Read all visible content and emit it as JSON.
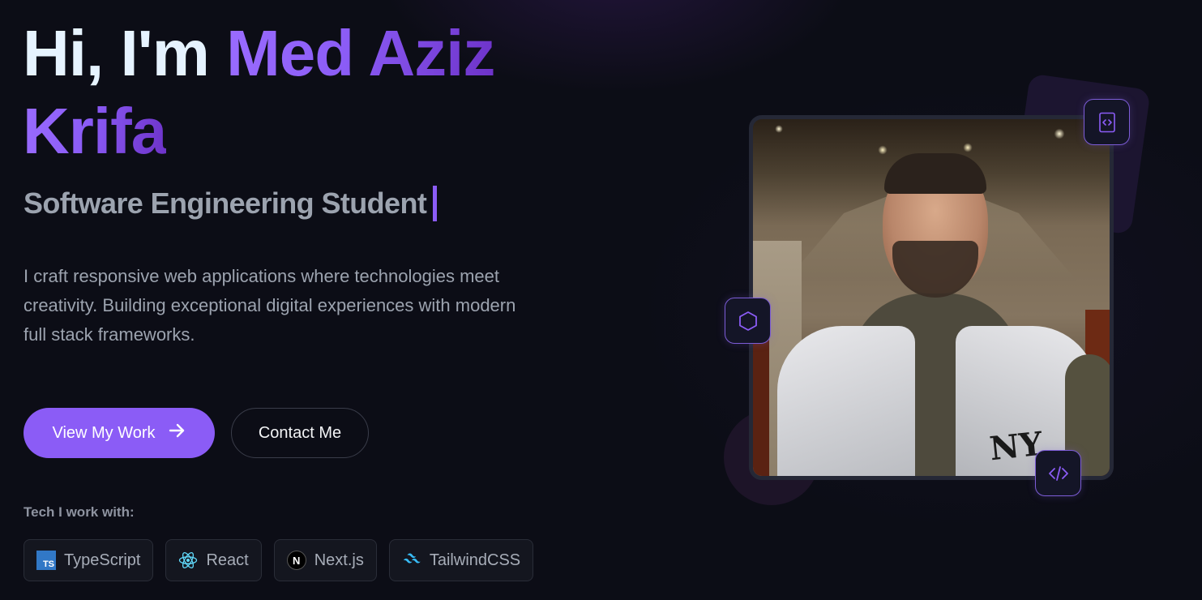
{
  "hero": {
    "greeting": "Hi, I'm ",
    "name_line1": "Med Aziz",
    "name_line2": "Krifa",
    "subtitle": "Software Engineering Student",
    "intro_line1": "I craft responsive web applications where technologies meet",
    "intro_line2": "creativity. Building exceptional digital experiences with modern",
    "intro_line3": "full stack frameworks."
  },
  "buttons": {
    "primary_label": "View My Work",
    "primary_icon": "arrow-right-icon",
    "secondary_label": "Contact Me"
  },
  "tech": {
    "label": "Tech I work with:",
    "items": [
      {
        "name": "TypeScript",
        "icon": "typescript-icon",
        "icon_text": "TS"
      },
      {
        "name": "React",
        "icon": "react-icon"
      },
      {
        "name": "Next.js",
        "icon": "nextjs-icon",
        "icon_text": "N"
      },
      {
        "name": "TailwindCSS",
        "icon": "tailwind-icon"
      }
    ]
  },
  "photo": {
    "alt": "portrait photo",
    "badges": [
      "code-file-icon",
      "hexagon-icon",
      "code-tag-icon"
    ],
    "shirt_text": "NY"
  },
  "colors": {
    "accent": "#8b5cf6",
    "background": "#0c0d16",
    "muted_text": "#9ca3af",
    "react": "#61dafb",
    "typescript": "#3178c6",
    "tailwind": "#38bdf8"
  }
}
